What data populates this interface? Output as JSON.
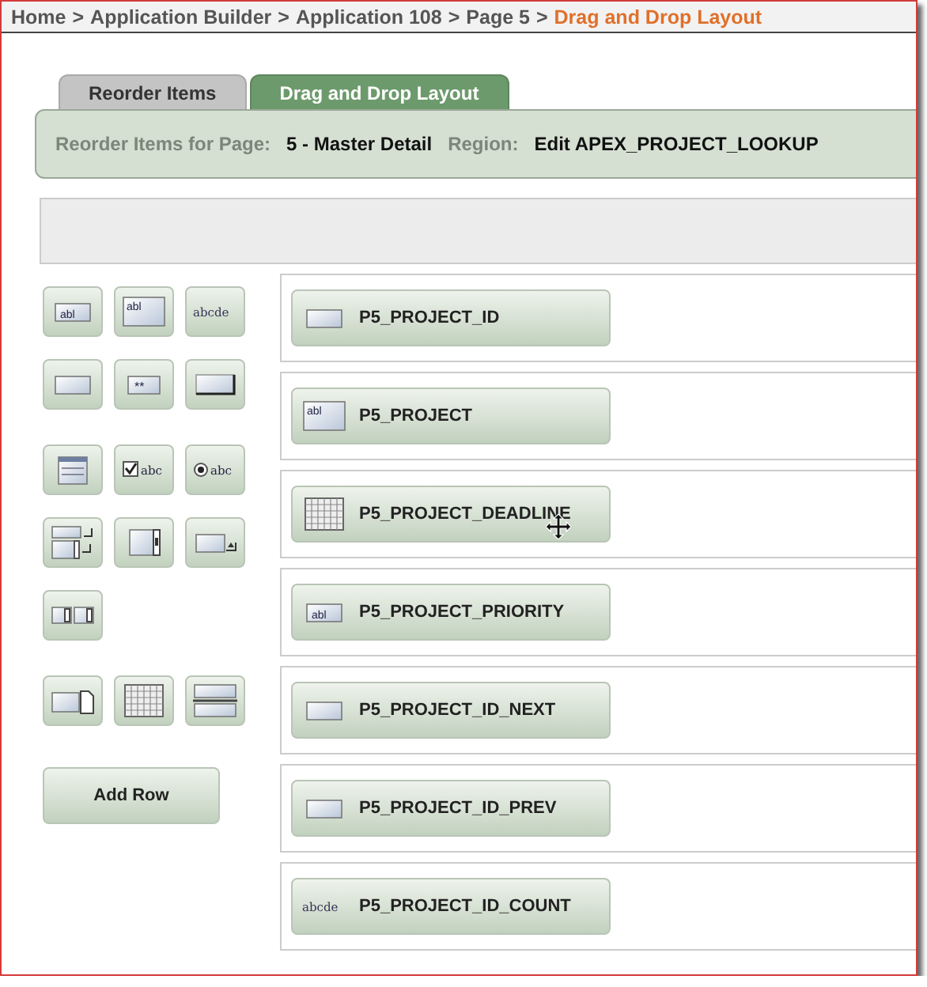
{
  "breadcrumb": [
    {
      "kind": "link",
      "label": "Home"
    },
    {
      "kind": "separator",
      "label": ">"
    },
    {
      "kind": "link",
      "label": "Application Builder"
    },
    {
      "kind": "separator",
      "label": ">"
    },
    {
      "kind": "link",
      "label": "Application 108"
    },
    {
      "kind": "separator",
      "label": ">"
    },
    {
      "kind": "link",
      "label": "Page 5"
    },
    {
      "kind": "separator",
      "label": ">"
    },
    {
      "kind": "current",
      "label": "Drag and Drop Layout"
    }
  ],
  "tabs": [
    {
      "label": "Reorder Items",
      "selected": false
    },
    {
      "label": "Drag and Drop Layout",
      "selected": true
    }
  ],
  "header": {
    "page_label": "Reorder Items for Page:",
    "page_value": "5 - Master Detail",
    "region_label": "Region:",
    "region_value": "Edit APEX_PROJECT_LOOKUP"
  },
  "palette_groups": [
    [
      [
        {
          "kind": "text-field",
          "text": "abl"
        },
        {
          "kind": "text-area",
          "text": "abl"
        },
        {
          "kind": "display",
          "text": "abcde"
        }
      ],
      [
        {
          "kind": "hidden"
        },
        {
          "kind": "password",
          "text": "**"
        },
        {
          "kind": "button"
        }
      ]
    ],
    [
      [
        {
          "kind": "select-list"
        },
        {
          "kind": "checkbox",
          "text": "abc"
        },
        {
          "kind": "radio",
          "text": "abc"
        }
      ],
      [
        {
          "kind": "shuttle"
        },
        {
          "kind": "list-box"
        },
        {
          "kind": "popup"
        }
      ],
      [
        {
          "kind": "list-pair"
        }
      ]
    ],
    [
      [
        {
          "kind": "file"
        },
        {
          "kind": "date"
        },
        {
          "kind": "stacked"
        }
      ]
    ]
  ],
  "add_row_button": "Add Row",
  "items": [
    {
      "name": "P5_PROJECT_ID",
      "kind": "hidden",
      "hovered": false
    },
    {
      "name": "P5_PROJECT",
      "kind": "text-area",
      "text": "abl",
      "hovered": false
    },
    {
      "name": "P5_PROJECT_DEADLINE",
      "kind": "date",
      "hovered": true
    },
    {
      "name": "P5_PROJECT_PRIORITY",
      "kind": "text-field",
      "text": "abl",
      "hovered": false
    },
    {
      "name": "P5_PROJECT_ID_NEXT",
      "kind": "hidden",
      "hovered": false
    },
    {
      "name": "P5_PROJECT_ID_PREV",
      "kind": "hidden",
      "hovered": false
    },
    {
      "name": "P5_PROJECT_ID_COUNT",
      "kind": "display",
      "text": "abcde",
      "hovered": false
    }
  ]
}
